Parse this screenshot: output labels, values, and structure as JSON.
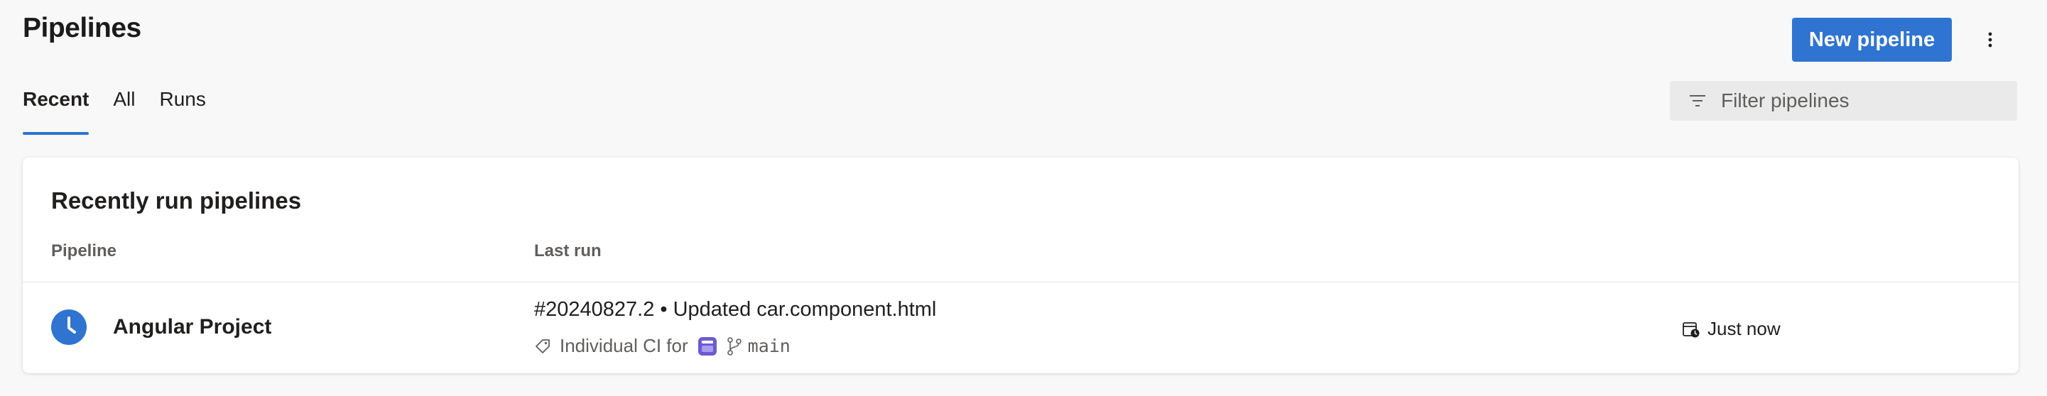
{
  "header": {
    "title": "Pipelines",
    "new_pipeline_label": "New pipeline",
    "more_icon": "more-vertical-icon"
  },
  "tabs": [
    {
      "label": "Recent",
      "active": true
    },
    {
      "label": "All",
      "active": false
    },
    {
      "label": "Runs",
      "active": false
    }
  ],
  "filter": {
    "placeholder": "Filter pipelines",
    "icon": "filter-icon"
  },
  "recent": {
    "title": "Recently run pipelines",
    "columns": {
      "pipeline": "Pipeline",
      "last_run": "Last run"
    },
    "rows": [
      {
        "status_icon": "clock-icon",
        "status": "queued",
        "name": "Angular Project",
        "run_title": "#20240827.2 • Updated car.component.html",
        "trigger": "Individual CI for",
        "repo_icon": "repo-icon",
        "branch_icon": "branch-icon",
        "branch": "main",
        "when_icon": "calendar-clock-icon",
        "when": "Just now"
      }
    ]
  },
  "colors": {
    "accent": "#2f74d0",
    "page_bg": "#f8f8f8",
    "repo_purple": "#6b5bd2"
  }
}
